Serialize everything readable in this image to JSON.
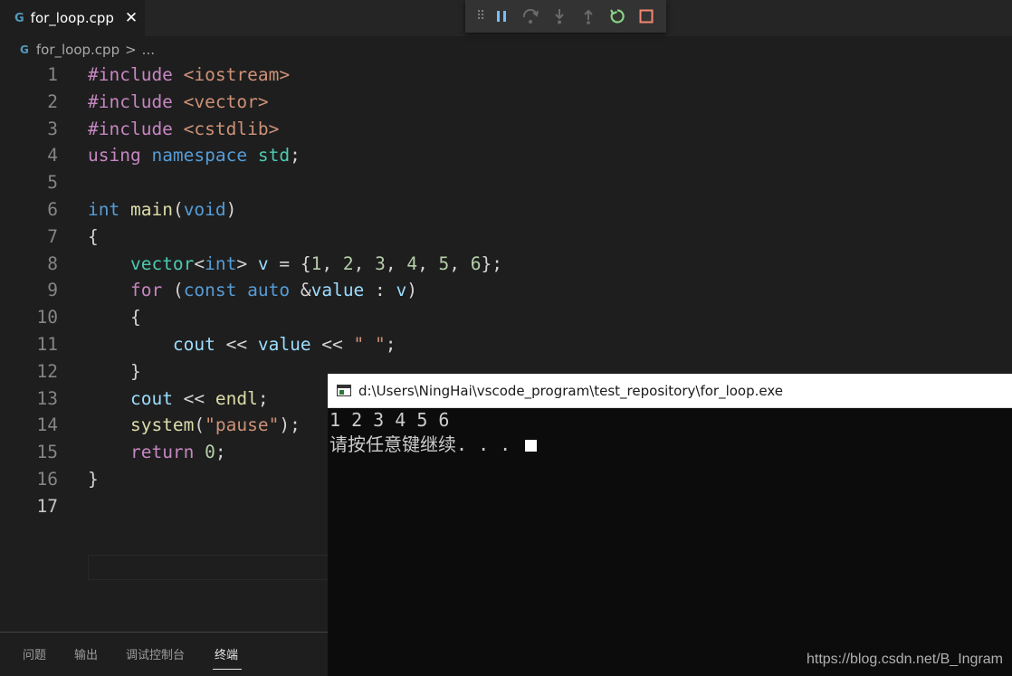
{
  "tab": {
    "filename": "for_loop.cpp",
    "file_icon": "C++ file",
    "close_glyph": "✕"
  },
  "debug_toolbar": {
    "buttons": [
      "pause",
      "step-over",
      "step-into",
      "step-out",
      "restart",
      "stop"
    ],
    "colors": {
      "accent": "#75beff",
      "restart": "#89d185",
      "stop": "#f48771"
    }
  },
  "breadcrumb": {
    "file": "for_loop.cpp",
    "separator": ">",
    "more": "..."
  },
  "editor": {
    "active_line": 17,
    "lines": [
      {
        "n": "1",
        "tokens": [
          {
            "t": "#include ",
            "c": "k-inc"
          },
          {
            "t": "<iostream>",
            "c": "k-str"
          }
        ]
      },
      {
        "n": "2",
        "tokens": [
          {
            "t": "#include ",
            "c": "k-inc"
          },
          {
            "t": "<vector>",
            "c": "k-str"
          }
        ]
      },
      {
        "n": "3",
        "tokens": [
          {
            "t": "#include ",
            "c": "k-inc"
          },
          {
            "t": "<cstdlib>",
            "c": "k-str"
          }
        ]
      },
      {
        "n": "4",
        "tokens": [
          {
            "t": "using ",
            "c": "k-ctl"
          },
          {
            "t": "namespace ",
            "c": "k-kw"
          },
          {
            "t": "std",
            "c": "k-type"
          },
          {
            "t": ";",
            "c": "k-def"
          }
        ]
      },
      {
        "n": "5",
        "tokens": []
      },
      {
        "n": "6",
        "tokens": [
          {
            "t": "int ",
            "c": "k-kw"
          },
          {
            "t": "main",
            "c": "k-fn"
          },
          {
            "t": "(",
            "c": "k-def"
          },
          {
            "t": "void",
            "c": "k-kw"
          },
          {
            "t": ")",
            "c": "k-def"
          }
        ]
      },
      {
        "n": "7",
        "tokens": [
          {
            "t": "{",
            "c": "k-def"
          }
        ]
      },
      {
        "n": "8",
        "tokens": [
          {
            "t": "    ",
            "c": "k-def"
          },
          {
            "t": "vector",
            "c": "k-type"
          },
          {
            "t": "<",
            "c": "k-def"
          },
          {
            "t": "int",
            "c": "k-kw"
          },
          {
            "t": "> ",
            "c": "k-def"
          },
          {
            "t": "v",
            "c": "k-var"
          },
          {
            "t": " = {",
            "c": "k-def"
          },
          {
            "t": "1",
            "c": "k-num"
          },
          {
            "t": ", ",
            "c": "k-def"
          },
          {
            "t": "2",
            "c": "k-num"
          },
          {
            "t": ", ",
            "c": "k-def"
          },
          {
            "t": "3",
            "c": "k-num"
          },
          {
            "t": ", ",
            "c": "k-def"
          },
          {
            "t": "4",
            "c": "k-num"
          },
          {
            "t": ", ",
            "c": "k-def"
          },
          {
            "t": "5",
            "c": "k-num"
          },
          {
            "t": ", ",
            "c": "k-def"
          },
          {
            "t": "6",
            "c": "k-num"
          },
          {
            "t": "};",
            "c": "k-def"
          }
        ]
      },
      {
        "n": "9",
        "tokens": [
          {
            "t": "    ",
            "c": "k-def"
          },
          {
            "t": "for",
            "c": "k-ctl"
          },
          {
            "t": " (",
            "c": "k-def"
          },
          {
            "t": "const ",
            "c": "k-kw"
          },
          {
            "t": "auto ",
            "c": "k-kw"
          },
          {
            "t": "&",
            "c": "k-def"
          },
          {
            "t": "value",
            "c": "k-var"
          },
          {
            "t": " : ",
            "c": "k-def"
          },
          {
            "t": "v",
            "c": "k-var"
          },
          {
            "t": ")",
            "c": "k-def"
          }
        ]
      },
      {
        "n": "10",
        "tokens": [
          {
            "t": "    {",
            "c": "k-def"
          }
        ]
      },
      {
        "n": "11",
        "tokens": [
          {
            "t": "        ",
            "c": "k-def"
          },
          {
            "t": "cout",
            "c": "k-var"
          },
          {
            "t": " << ",
            "c": "k-def"
          },
          {
            "t": "value",
            "c": "k-var"
          },
          {
            "t": " << ",
            "c": "k-def"
          },
          {
            "t": "\" \"",
            "c": "k-str"
          },
          {
            "t": ";",
            "c": "k-def"
          }
        ]
      },
      {
        "n": "12",
        "tokens": [
          {
            "t": "    }",
            "c": "k-def"
          }
        ]
      },
      {
        "n": "13",
        "tokens": [
          {
            "t": "    ",
            "c": "k-def"
          },
          {
            "t": "cout",
            "c": "k-var"
          },
          {
            "t": " << ",
            "c": "k-def"
          },
          {
            "t": "endl",
            "c": "k-fn"
          },
          {
            "t": ";",
            "c": "k-def"
          }
        ]
      },
      {
        "n": "14",
        "tokens": [
          {
            "t": "    ",
            "c": "k-def"
          },
          {
            "t": "system",
            "c": "k-fn"
          },
          {
            "t": "(",
            "c": "k-def"
          },
          {
            "t": "\"pause\"",
            "c": "k-str"
          },
          {
            "t": ");",
            "c": "k-def"
          }
        ]
      },
      {
        "n": "15",
        "tokens": [
          {
            "t": "    ",
            "c": "k-def"
          },
          {
            "t": "return ",
            "c": "k-ctl"
          },
          {
            "t": "0",
            "c": "k-num"
          },
          {
            "t": ";",
            "c": "k-def"
          }
        ]
      },
      {
        "n": "16",
        "tokens": [
          {
            "t": "}",
            "c": "k-def"
          }
        ]
      },
      {
        "n": "17",
        "tokens": []
      }
    ]
  },
  "panel_tabs": [
    {
      "label": "问题",
      "active": false
    },
    {
      "label": "输出",
      "active": false
    },
    {
      "label": "调试控制台",
      "active": false
    },
    {
      "label": "终端",
      "active": true
    }
  ],
  "console": {
    "title": "d:\\Users\\NingHai\\vscode_program\\test_repository\\for_loop.exe",
    "lines": [
      "1 2 3 4 5 6",
      "请按任意键继续. . . "
    ]
  },
  "watermark": "https://blog.csdn.net/B_Ingram"
}
